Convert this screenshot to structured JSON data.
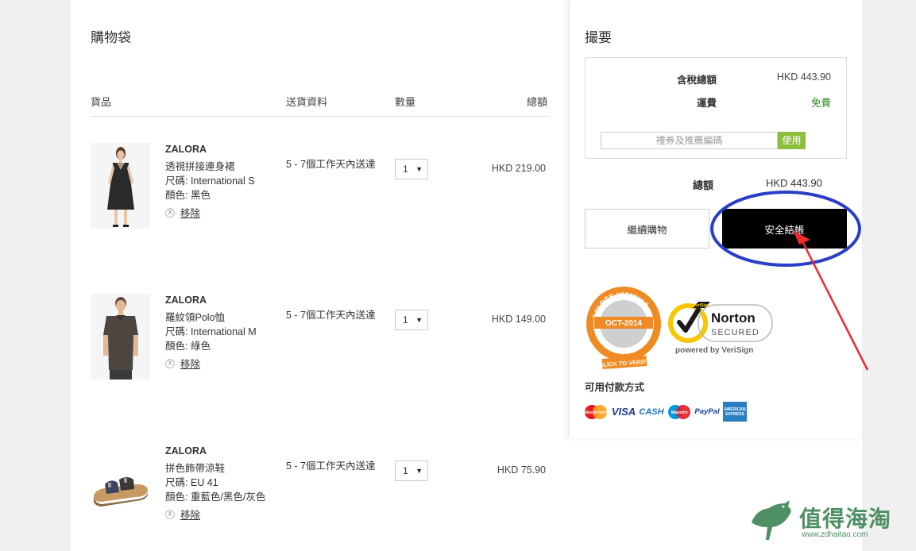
{
  "cart": {
    "title": "購物袋",
    "columns": {
      "item": "貨品",
      "shipping": "送貨資料",
      "quantity": "數量",
      "total": "總額"
    },
    "items": [
      {
        "brand": "ZALORA",
        "name": "透視拼接連身裙",
        "size": "尺碼: International S",
        "color": "顏色: 黑色",
        "remove": "移除",
        "remove_icon": "X",
        "shipping": "5 - 7個工作天內送達",
        "qty": "1",
        "price": "HKD 219.00"
      },
      {
        "brand": "ZALORA",
        "name": "羅紋領Polo恤",
        "size": "尺碼: International M",
        "color": "顏色: 綠色",
        "remove": "移除",
        "remove_icon": "X",
        "shipping": "5 - 7個工作天內送達",
        "qty": "1",
        "price": "HKD 149.00"
      },
      {
        "brand": "ZALORA",
        "name": "拼色飾帶涼鞋",
        "size": "尺碼: EU 41",
        "color": "顏色: 重藍色/黑色/灰色",
        "remove": "移除",
        "remove_icon": "X",
        "shipping": "5 - 7個工作天內送達",
        "qty": "1",
        "price": "HKD 75.90"
      }
    ]
  },
  "summary": {
    "title": "撮要",
    "tax_total_label": "含稅總額",
    "tax_total_value": "HKD 443.90",
    "shipping_label": "運費",
    "shipping_value": "免費",
    "coupon_placeholder": "禮券及推薦編碼",
    "coupon_button": "使用",
    "total_label": "總額",
    "total_value": "HKD 443.90",
    "continue_button": "繼續購物",
    "checkout_button": "安全結帳",
    "pci": {
      "top": "PCI DSS approved",
      "date": "OCT-2014",
      "bottom": "more security · usd",
      "verify": "CLICK TO VERIFY"
    },
    "norton": {
      "name": "Norton",
      "secured": "SECURED",
      "powered": "powered by VeriSign",
      "badge": "VeriSign"
    },
    "payment_title": "可用付款方式",
    "payment_methods": [
      {
        "icon": "mastercard-icon",
        "label": "MasterCard"
      },
      {
        "icon": "visa-icon",
        "label": "VISA"
      },
      {
        "icon": "cash-on-delivery-icon",
        "label": "CASH"
      },
      {
        "icon": "maestro-icon",
        "label": "Maestro"
      },
      {
        "icon": "paypal-icon",
        "label": "PayPal"
      },
      {
        "icon": "amex-icon",
        "label": "AMERICAN EXPRESS"
      }
    ]
  },
  "watermark": {
    "text": "值得海淘",
    "url": "www.zdhaitao.com"
  },
  "colors": {
    "accent_green": "#8dbf3c",
    "checkout_bg": "#000000",
    "annotation_blue": "#2a3fc7",
    "annotation_red": "#ee2a2a",
    "watermark_green": "#4e8f63"
  }
}
